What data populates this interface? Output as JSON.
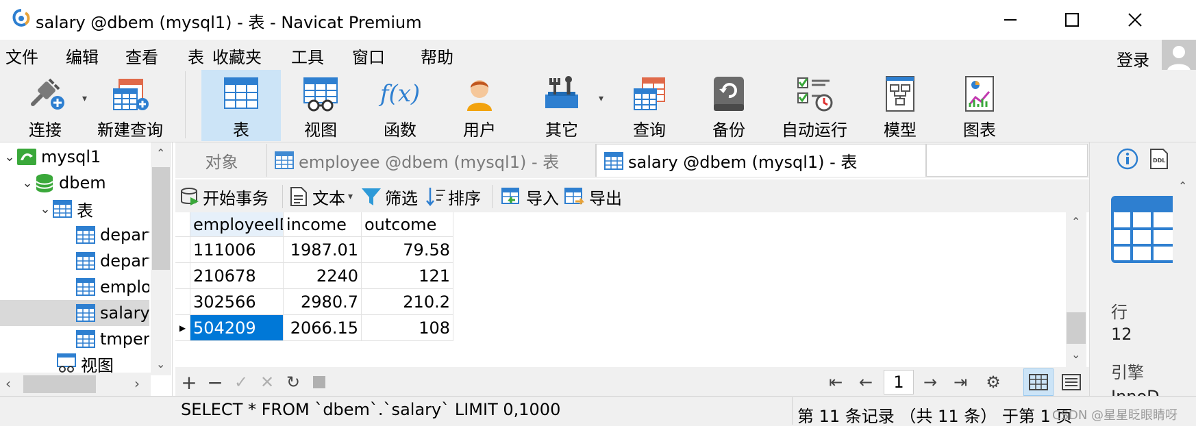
{
  "window": {
    "title": "salary @dbem (mysql1) - 表 - Navicat Premium",
    "minimize_glyph": "—",
    "maximize_glyph": "☐",
    "close_glyph": "✕"
  },
  "menu": {
    "items": [
      "文件",
      "编辑",
      "查看",
      "表",
      "收藏夹",
      "工具",
      "窗口",
      "帮助"
    ],
    "login": "登录"
  },
  "toolbar": {
    "items": [
      {
        "label": "连接",
        "icon": "plug-icon"
      },
      {
        "label": "新建查询",
        "icon": "new-query-icon"
      },
      {
        "label": "表",
        "icon": "table-icon",
        "active": true
      },
      {
        "label": "视图",
        "icon": "view-icon"
      },
      {
        "label": "函数",
        "icon": "function-icon",
        "glyph": "f(x)"
      },
      {
        "label": "用户",
        "icon": "user-icon"
      },
      {
        "label": "其它",
        "icon": "tools-icon"
      },
      {
        "label": "查询",
        "icon": "query-icon"
      },
      {
        "label": "备份",
        "icon": "backup-icon"
      },
      {
        "label": "自动运行",
        "icon": "schedule-icon"
      },
      {
        "label": "模型",
        "icon": "model-icon"
      },
      {
        "label": "图表",
        "icon": "chart-icon"
      }
    ]
  },
  "sidebar": {
    "tree": [
      {
        "label": "mysql1",
        "level": 0,
        "expanded": true,
        "icon": "mysql-connection-icon"
      },
      {
        "label": "dbem",
        "level": 1,
        "expanded": true,
        "icon": "database-icon"
      },
      {
        "label": "表",
        "level": 2,
        "expanded": true,
        "icon": "tables-folder-icon"
      },
      {
        "label": "depart",
        "level": 3,
        "icon": "table-icon"
      },
      {
        "label": "depart",
        "level": 3,
        "icon": "table-icon"
      },
      {
        "label": "emplo",
        "level": 3,
        "icon": "table-icon"
      },
      {
        "label": "salary",
        "level": 3,
        "icon": "table-icon",
        "selected": true
      },
      {
        "label": "tmper",
        "level": 3,
        "icon": "table-icon"
      },
      {
        "label": "视图",
        "level": 2,
        "icon": "views-folder-icon"
      }
    ]
  },
  "tabs": [
    {
      "label": "对象",
      "state": "inactive"
    },
    {
      "label": "employee @dbem (mysql1) - 表",
      "state": "inactive"
    },
    {
      "label": "salary @dbem (mysql1) - 表",
      "state": "active"
    }
  ],
  "grid_toolbar": {
    "begin_transaction": "开始事务",
    "text": "文本",
    "filter": "筛选",
    "sort": "排序",
    "import": "导入",
    "export": "导出"
  },
  "table": {
    "columns": [
      "employeeID",
      "income",
      "outcome"
    ],
    "rows": [
      [
        "111006",
        "1987.01",
        "79.58"
      ],
      [
        "210678",
        "2240",
        "121"
      ],
      [
        "302566",
        "2980.7",
        "210.2"
      ],
      [
        "504209",
        "2066.15",
        "108"
      ]
    ]
  },
  "nav": {
    "page": "1"
  },
  "status": {
    "sql": "SELECT * FROM `dbem`.`salary` LIMIT 0,1000",
    "record": "第 11 条记录 （共 11 条） 于第 1 页"
  },
  "info_panel": {
    "rows_label": "行",
    "rows_value": "12",
    "engine_label": "引擎",
    "engine_value": "InnoD"
  },
  "watermark": "CSDN @星星眨眼睛呀",
  "colors": {
    "selection": "#0078d7",
    "tool_active": "#cce4f7",
    "icon_blue": "#2e7fd0",
    "chrome": "#f0f0f0"
  }
}
